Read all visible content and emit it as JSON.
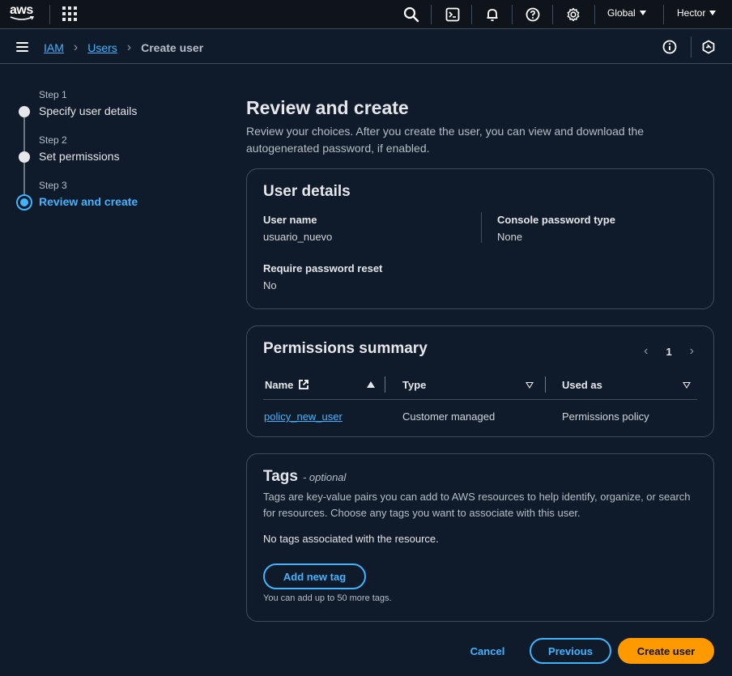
{
  "topnav": {
    "logo_text": "aws",
    "region": "Global",
    "user": "Hector",
    "icons": [
      "apps-grid-icon",
      "search-icon",
      "cloudshell-icon",
      "bell-icon",
      "help-icon",
      "gear-icon"
    ]
  },
  "breadcrumb": {
    "items": [
      "IAM",
      "Users"
    ],
    "current": "Create user"
  },
  "wizard": {
    "steps": [
      {
        "small": "Step 1",
        "label": "Specify user details"
      },
      {
        "small": "Step 2",
        "label": "Set permissions"
      },
      {
        "small": "Step 3",
        "label": "Review and create"
      }
    ]
  },
  "header": {
    "title": "Review and create",
    "description": "Review your choices. After you create the user, you can view and download the autogenerated password, if enabled."
  },
  "user_details": {
    "title": "User details",
    "user_name_label": "User name",
    "user_name_value": "usuario_nuevo",
    "console_pw_label": "Console password type",
    "console_pw_value": "None",
    "reset_label": "Require password reset",
    "reset_value": "No"
  },
  "permissions": {
    "title": "Permissions summary",
    "page": "1",
    "columns": [
      "Name",
      "Type",
      "Used as"
    ],
    "rows": [
      {
        "name": "policy_new_user",
        "type": "Customer managed",
        "used_as": "Permissions policy"
      }
    ]
  },
  "tags": {
    "title": "Tags",
    "optional": "- optional",
    "description": "Tags are key-value pairs you can add to AWS resources to help identify, organize, or search for resources. Choose any tags you want to associate with this user.",
    "empty": "No tags associated with the resource.",
    "add_button": "Add new tag",
    "hint": "You can add up to 50 more tags."
  },
  "footer": {
    "cancel": "Cancel",
    "previous": "Previous",
    "create": "Create user"
  },
  "colors": {
    "accent": "#42b4ff",
    "primary_button": "#ff9900",
    "background": "#0f1b2a"
  }
}
